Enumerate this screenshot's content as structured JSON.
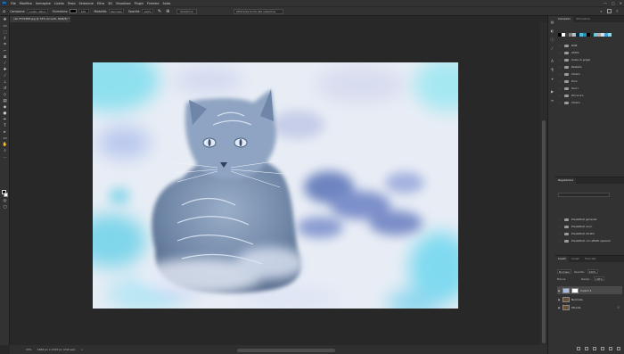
{
  "app": {
    "logo": "Ps"
  },
  "menu": {
    "items": [
      "File",
      "Modifica",
      "Immagine",
      "Livello",
      "Testo",
      "Selezione",
      "Filtro",
      "3D",
      "Visualizza",
      "Plugin",
      "Finestra",
      "Aiuto"
    ]
  },
  "window_controls": {
    "minimize": "—",
    "maximize": "▢",
    "close": "✕"
  },
  "options_bar": {
    "tool_label": "Campiona:",
    "tool_value": "Livello attivo",
    "color_label": "Sfumatura:",
    "size_value": "100",
    "mode_label": "Modalità:",
    "mode_value": "Normale",
    "opacity_label": "Opacità:",
    "opacity_value": "100%",
    "button_label": "Selezione",
    "search_text": "Ottimizza bordi alla selezione"
  },
  "document_tab": {
    "title": "cat-7570388.jpg @ 33% (Inverti, RGB/8) *"
  },
  "status": {
    "zoom": "33%",
    "doc_info": "3484 px x 2325 px (240 ppi)",
    "arrow": ">"
  },
  "panels": {
    "top_tabs": [
      "Campioni",
      "Sfumature"
    ],
    "swatch_colors": [
      "#000000",
      "#ffffff",
      "#3f3f3f",
      "#7f7f7f",
      "#bfbfbf",
      "#0a2a4a",
      "#4fbfcf",
      "#1f8fbf",
      "#000000",
      "#2f2f2f",
      "#5fcfdf",
      "#afafaf",
      "#dfdfdf",
      "#3f9fdf",
      "#7fdfef"
    ],
    "swatch_folders": [
      "RGB",
      "CMYK",
      "Scala di grigio",
      "Pastello",
      "Chiaro",
      "Puro",
      "Scuri",
      "Più scuro",
      "Chiaro"
    ],
    "adjustments_title": "Regolazioni",
    "adjustment_folders": [
      "Predefiniti generali",
      "Predefiniti scuri",
      "Predefiniti ritratti",
      "Predefiniti con effetti speciali"
    ],
    "layers_tabs": [
      "Livelli",
      "Canali",
      "Tracciati"
    ],
    "blend_mode": "Normale",
    "opacity_label": "Opacità:",
    "opacity_value": "100%",
    "lock_label": "Blocca:",
    "fill_label": "Riemp.:",
    "fill_value": "100%",
    "layers": [
      {
        "name": "Inverti 1",
        "selected": true
      },
      {
        "name": "Normale",
        "selected": false
      },
      {
        "name": "Sfondo",
        "selected": false
      }
    ]
  },
  "tools": [
    "move",
    "artboard",
    "marquee",
    "lasso",
    "object-select",
    "crop",
    "frame",
    "eyedropper",
    "healing",
    "brush",
    "clone-stamp",
    "history-brush",
    "eraser",
    "gradient",
    "blur",
    "dodge",
    "pen",
    "type",
    "path-select",
    "rectangle",
    "hand",
    "zoom",
    "more"
  ]
}
